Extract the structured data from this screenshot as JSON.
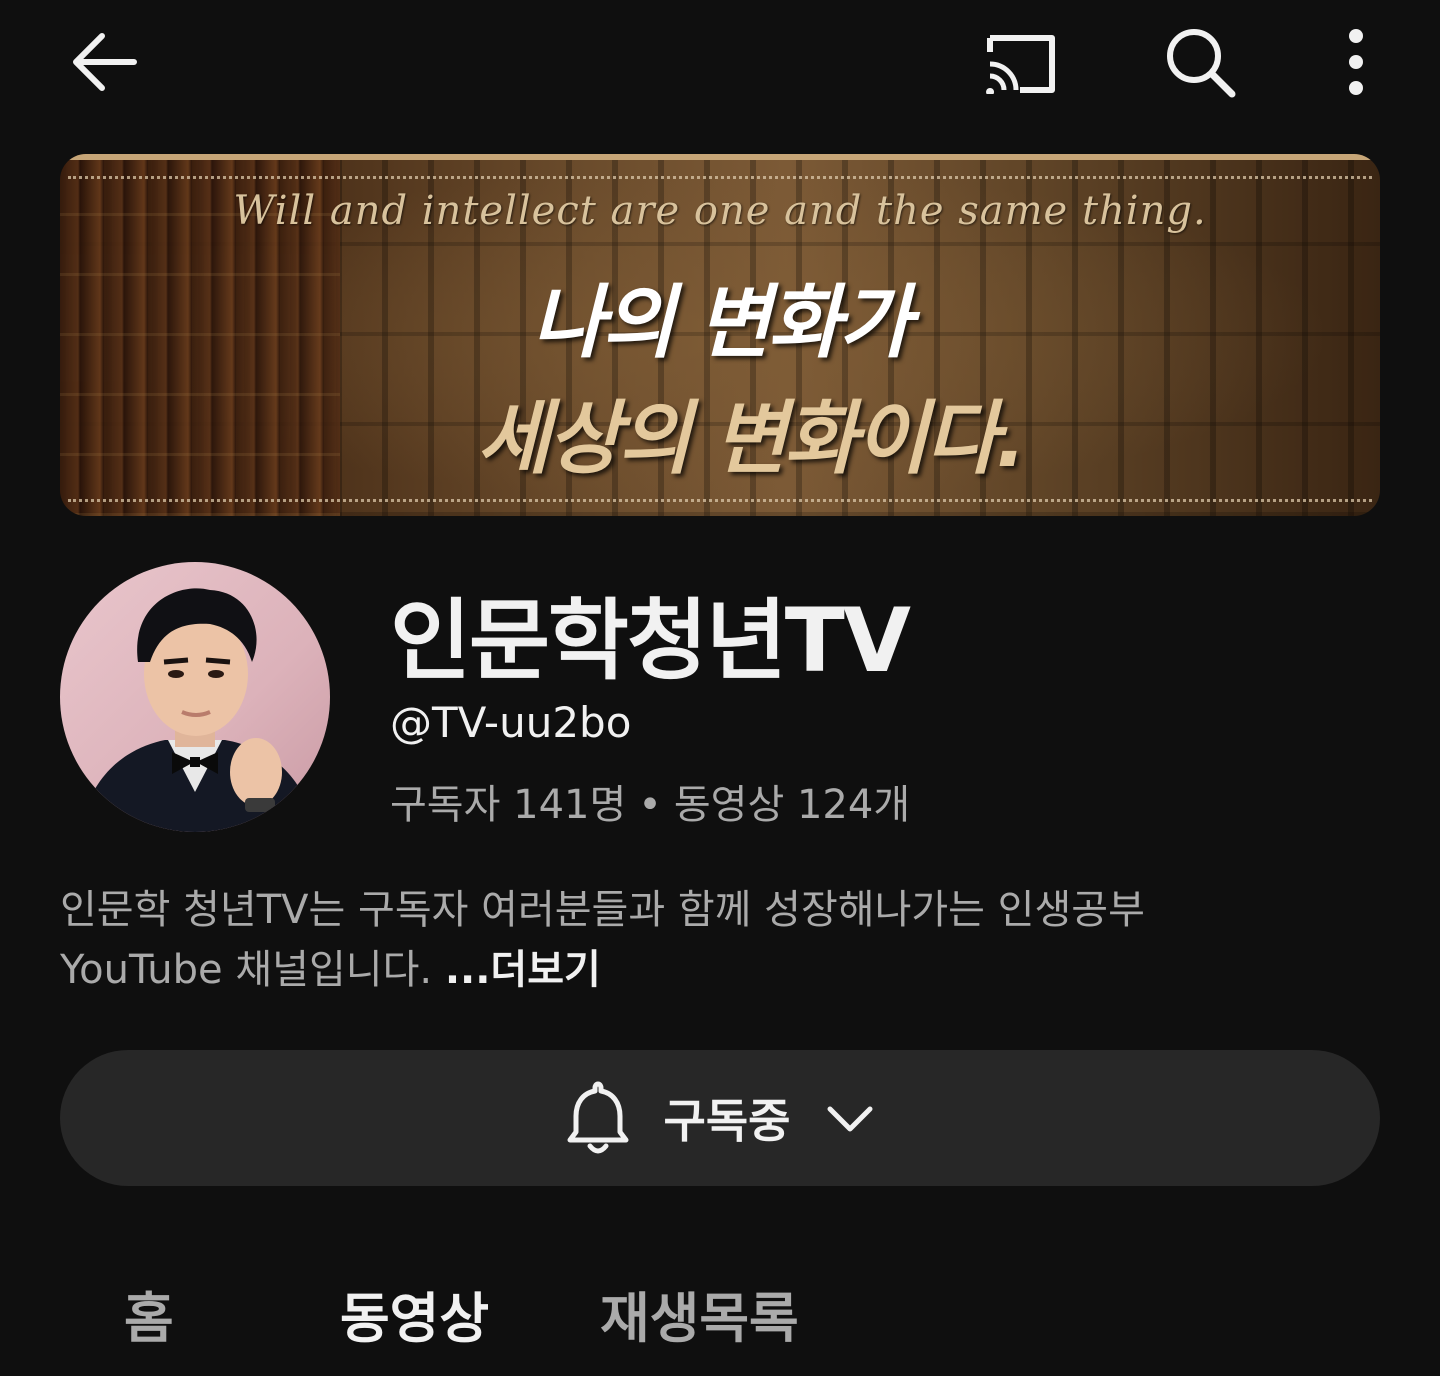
{
  "topbar": {
    "back_icon": "arrow-left-icon",
    "cast_icon": "cast-icon",
    "search_icon": "search-icon",
    "more_icon": "more-vertical-icon"
  },
  "banner": {
    "quote": "Will and intellect are one and the same thing.",
    "headline_1": "나의 변화가",
    "headline_2": "세상의 변화이다.",
    "accent_color": "#e3c89c"
  },
  "channel": {
    "name": "인문학청년TV",
    "handle": "@TV-uu2bo",
    "subscribers": "구독자 141명",
    "separator": "•",
    "videos": "동영상 124개"
  },
  "description": {
    "text_line1": "인문학 청년TV는 구독자 여러분들과 함께 성장해나가는 인생공부",
    "text_line2": "YouTube 채널입니다. ",
    "more_label": "...더보기"
  },
  "subscribe": {
    "label": "구독중",
    "bell_icon": "bell-icon",
    "chevron_icon": "chevron-down-icon"
  },
  "tabs": [
    {
      "label": "홈",
      "active": false
    },
    {
      "label": "동영상",
      "active": true
    },
    {
      "label": "재생목록",
      "active": false
    }
  ],
  "colors": {
    "background": "#0f0f0f",
    "surface": "#272727",
    "text_primary": "#f1f1f1",
    "text_secondary": "#aaaaaa"
  }
}
